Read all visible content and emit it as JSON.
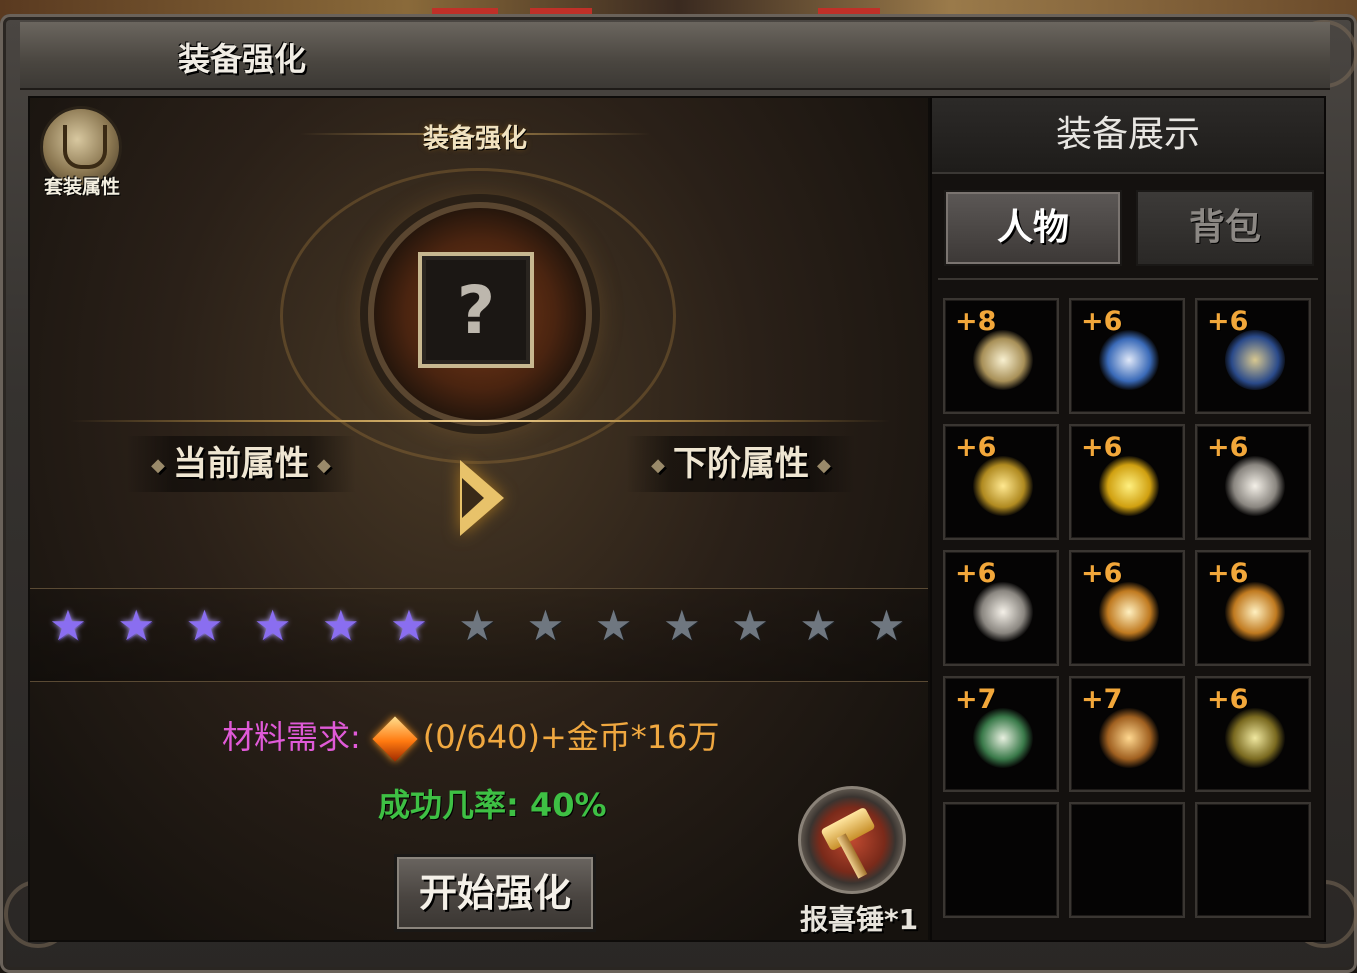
{
  "window": {
    "title": "装备强化"
  },
  "left_panel": {
    "set_button_label": "套装属性",
    "section_title": "装备强化",
    "empty_slot_symbol": "?",
    "current_attr_label": "当前属性",
    "next_attr_label": "下阶属性",
    "stars": {
      "total": 13,
      "lit": 6
    },
    "material": {
      "label": "材料需求:",
      "value": "(0/640)+金币*16万",
      "icon": "fire-gem-icon"
    },
    "success_rate": "成功几率: 40%",
    "start_button": "开始强化",
    "hammer": {
      "label": "报喜锤*1",
      "icon": "hammer-icon"
    }
  },
  "right_panel": {
    "header": "装备展示",
    "tabs": [
      {
        "label": "人物",
        "active": true
      },
      {
        "label": "背包",
        "active": false
      }
    ],
    "items": [
      {
        "level": "+8",
        "icon": "sword-icon"
      },
      {
        "level": "+6",
        "icon": "armor-icon"
      },
      {
        "level": "+6",
        "icon": "helmet-icon"
      },
      {
        "level": "+6",
        "icon": "necklace-icon"
      },
      {
        "level": "+6",
        "icon": "dragon-amulet-icon"
      },
      {
        "level": "+6",
        "icon": "bracelet-icon"
      },
      {
        "level": "+6",
        "icon": "bracelet-icon"
      },
      {
        "level": "+6",
        "icon": "ring-icon"
      },
      {
        "level": "+6",
        "icon": "ring-icon"
      },
      {
        "level": "+7",
        "icon": "belt-icon"
      },
      {
        "level": "+7",
        "icon": "boots-icon"
      },
      {
        "level": "+6",
        "icon": "gem-icon"
      },
      {
        "level": "",
        "icon": ""
      },
      {
        "level": "",
        "icon": ""
      },
      {
        "level": "",
        "icon": ""
      }
    ]
  },
  "colors": {
    "lit_star": "#8a6ef0",
    "unlit_star": "#6f7780",
    "material_label": "#e05ad8",
    "material_value": "#f0a840",
    "success_rate": "#3ec044",
    "item_level": "#f2a73a"
  }
}
